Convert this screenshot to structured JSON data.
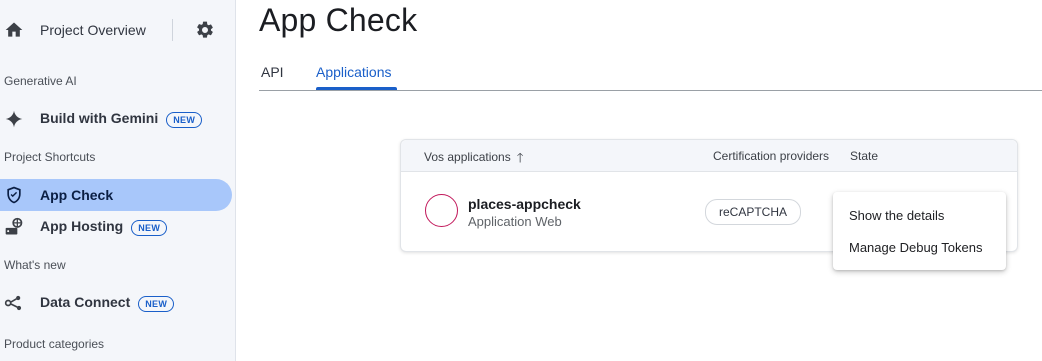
{
  "sidebar": {
    "project_overview": "Project Overview",
    "sections": {
      "generative_ai": "Generative AI",
      "project_shortcuts": "Project Shortcuts",
      "whats_new": "What's new",
      "product_categories": "Product categories"
    },
    "items": {
      "build_with_gemini": {
        "label": "Build with Gemini",
        "badge": "NEW"
      },
      "app_check": {
        "label": "App Check"
      },
      "app_hosting": {
        "label": "App Hosting",
        "badge": "NEW"
      },
      "data_connect": {
        "label": "Data Connect",
        "badge": "NEW"
      }
    },
    "icons": {
      "home": "home-icon",
      "settings": "gear-icon",
      "gemini": "sparkle-icon",
      "app_check": "shield-check-icon",
      "app_hosting": "hosting-icon",
      "data_connect": "data-connect-icon"
    }
  },
  "main": {
    "title": "App Check",
    "tabs": [
      {
        "label": "API"
      },
      {
        "label": "Applications",
        "active": true
      }
    ],
    "table": {
      "columns": [
        "Vos applications",
        "Certification providers",
        "State"
      ],
      "sort_icon": "arrow-up-icon",
      "rows": [
        {
          "name": "places-appcheck",
          "type": "Application Web",
          "provider": "reCAPTCHA"
        }
      ]
    },
    "menu": {
      "items": [
        "Show the details",
        "Manage Debug Tokens"
      ]
    }
  },
  "colors": {
    "accent": "#1a5fc9",
    "active_nav_bg": "#a8c7fa",
    "app_circle": "#c2185b"
  }
}
